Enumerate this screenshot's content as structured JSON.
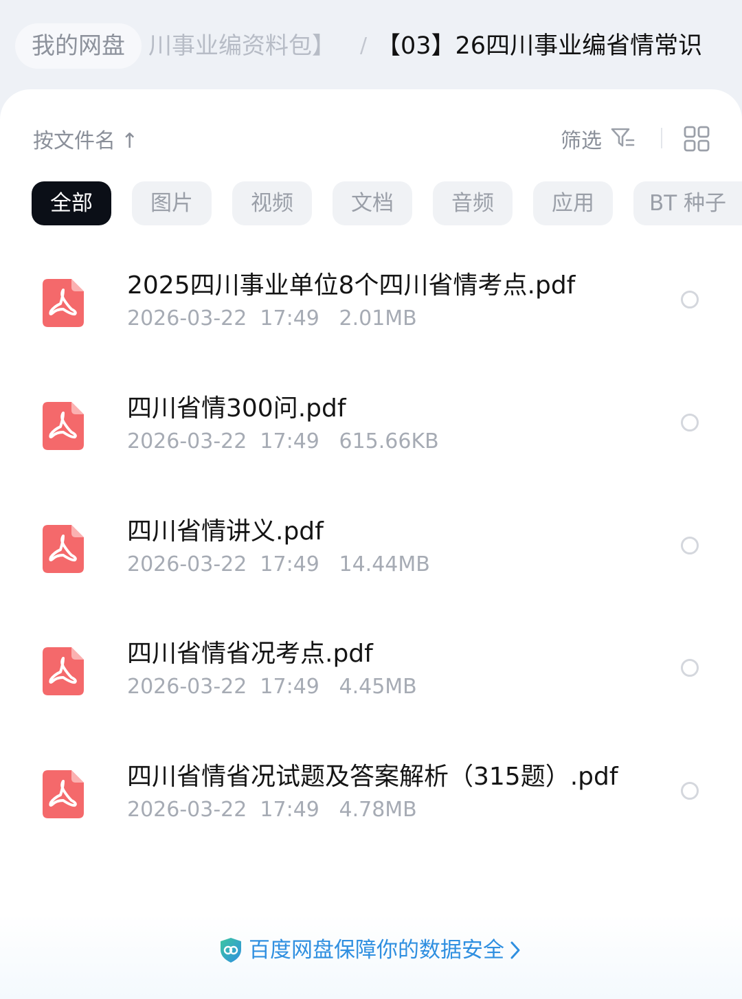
{
  "breadcrumb": {
    "home": "我的网盘",
    "middle": "川事业编资料包】",
    "separator": "/",
    "current": "【03】26四川事业编省情常识"
  },
  "toolbar": {
    "sort_label": "按文件名",
    "sort_arrow": "↑",
    "filter_label": "筛选"
  },
  "tabs": [
    {
      "label": "全部",
      "active": true
    },
    {
      "label": "图片",
      "active": false
    },
    {
      "label": "视频",
      "active": false
    },
    {
      "label": "文档",
      "active": false
    },
    {
      "label": "音频",
      "active": false
    },
    {
      "label": "应用",
      "active": false
    },
    {
      "label": "BT 种子",
      "active": false
    }
  ],
  "files": [
    {
      "name": "2025四川事业单位8个四川省情考点.pdf",
      "meta": "2026-03-22  17:49   2.01MB"
    },
    {
      "name": "四川省情300问.pdf",
      "meta": "2026-03-22  17:49   615.66KB"
    },
    {
      "name": "四川省情讲义.pdf",
      "meta": "2026-03-22  17:49   14.44MB"
    },
    {
      "name": "四川省情省况考点.pdf",
      "meta": "2026-03-22  17:49   4.45MB"
    },
    {
      "name": "四川省情省况试题及答案解析（315题）.pdf",
      "meta": "2026-03-22  17:49   4.78MB"
    }
  ],
  "footer": {
    "text": "百度网盘保障你的数据安全"
  },
  "icons": {
    "file": "pdf-file-icon",
    "filter": "filter-icon",
    "view": "grid-view-icon",
    "security": "shield-icon",
    "more": "chevron-right-icon"
  },
  "colors": {
    "pdf": "#f4696b",
    "active_tab": "#0b0f17",
    "footer_link": "#2f8fe0"
  }
}
